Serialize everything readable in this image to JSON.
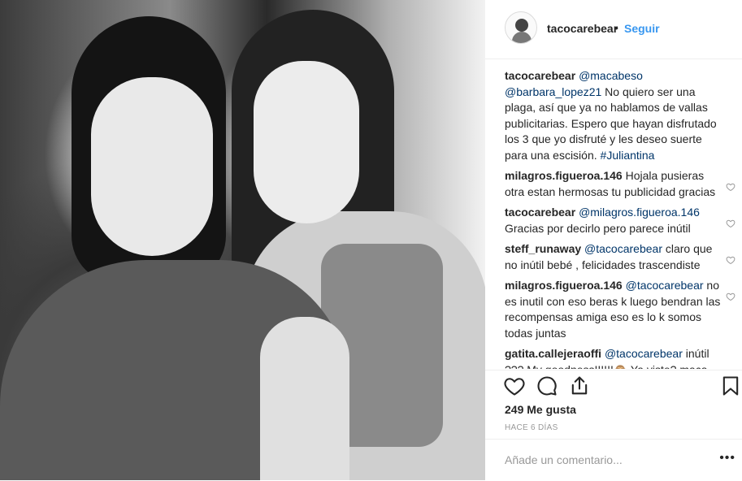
{
  "post": {
    "photo_alt": "Black and white selfie of two young women",
    "header": {
      "username": "tacocarebear",
      "dot": "•",
      "follow_label": "Seguir"
    },
    "comments": [
      {
        "user": "tacocarebear",
        "parts": [
          {
            "type": "mention",
            "text": "@macabeso"
          },
          {
            "type": "text",
            "text": " "
          },
          {
            "type": "mention",
            "text": "@barbara_lopez21"
          },
          {
            "type": "text",
            "text": " No quiero ser una plaga, así que ya no hablamos de vallas publicitarias. Espero que hayan disfrutado los 3 que yo disfruté y les deseo suerte para una escisión. "
          },
          {
            "type": "hashtag",
            "text": "#Juliantina"
          }
        ],
        "heart": false
      },
      {
        "user": "milagros.figueroa.146",
        "parts": [
          {
            "type": "text",
            "text": "Hojala pusieras otra estan hermosas tu publicidad gracias"
          }
        ],
        "heart": true
      },
      {
        "user": "tacocarebear",
        "parts": [
          {
            "type": "mention",
            "text": "@milagros.figueroa.146"
          },
          {
            "type": "text",
            "text": " Gracias por decirlo pero parece inútil"
          }
        ],
        "heart": true
      },
      {
        "user": "steff_runaway",
        "parts": [
          {
            "type": "mention",
            "text": "@tacocarebear"
          },
          {
            "type": "text",
            "text": " claro que no inútil bebé , felicidades trascendiste"
          }
        ],
        "heart": true
      },
      {
        "user": "milagros.figueroa.146",
        "parts": [
          {
            "type": "mention",
            "text": "@tacocarebear"
          },
          {
            "type": "text",
            "text": " no es inutil con eso beras k luego bendran las recompensas amiga eso es lo k somos todas juntas"
          }
        ],
        "heart": true
      },
      {
        "user": "gatita.callejeraoffi",
        "parts": [
          {
            "type": "mention",
            "text": "@tacocarebear"
          },
          {
            "type": "text",
            "text": " inútil ??? My goodness!!!!!!🙈 Ya viste? maca"
          }
        ],
        "heart": false
      }
    ],
    "actions": {
      "like_icon": "heart-icon",
      "comment_icon": "comment-icon",
      "share_icon": "share-icon",
      "save_icon": "bookmark-icon"
    },
    "likes": "249 Me gusta",
    "time": "HACE 6 DÍAS",
    "add_comment": {
      "placeholder": "Añade un comentario...",
      "more": "•••"
    }
  }
}
